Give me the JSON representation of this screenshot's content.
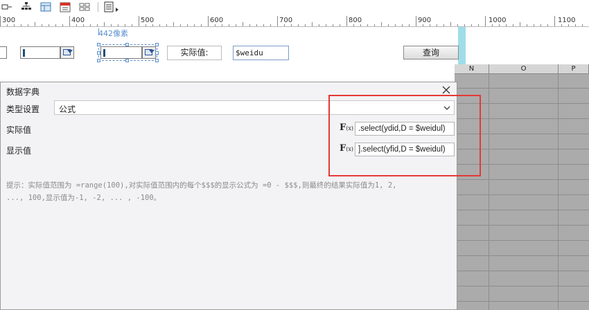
{
  "toolbar": {
    "icons": [
      "align-icon",
      "tree-icon",
      "layout-icon",
      "calendar-icon",
      "grid-icon",
      "report-icon"
    ]
  },
  "ruler": {
    "labels": [
      "300",
      "400",
      "500",
      "600",
      "700",
      "800",
      "900",
      "1000",
      "1100"
    ]
  },
  "canvas": {
    "width_hint": "442像素",
    "actual_value_label": "实际值:",
    "weidu_value": "$weidu",
    "query_button": "查询"
  },
  "grid": {
    "columns": [
      "N",
      "O",
      "P"
    ]
  },
  "dialog": {
    "title": "数据字典",
    "type_label": "类型设置",
    "type_value": "公式",
    "actual_label": "实际值",
    "actual_formula": ".select(ydid,D = $weidul)",
    "display_label": "显示值",
    "display_formula": "].select(yfid,D = $weidul)",
    "hint_line1": "提示：实际值范围为 =range(100),对实际值范围内的每个$$$的显示公式为 =0 - $$$,则最终的结果实际值为1, 2,",
    "hint_line2": "..., 100,显示值为-1, -2, ... , -100。"
  },
  "colors": {
    "highlight_border": "#e53935",
    "cyan_bar": "#9fdde8",
    "grid_bg": "#ababab"
  }
}
